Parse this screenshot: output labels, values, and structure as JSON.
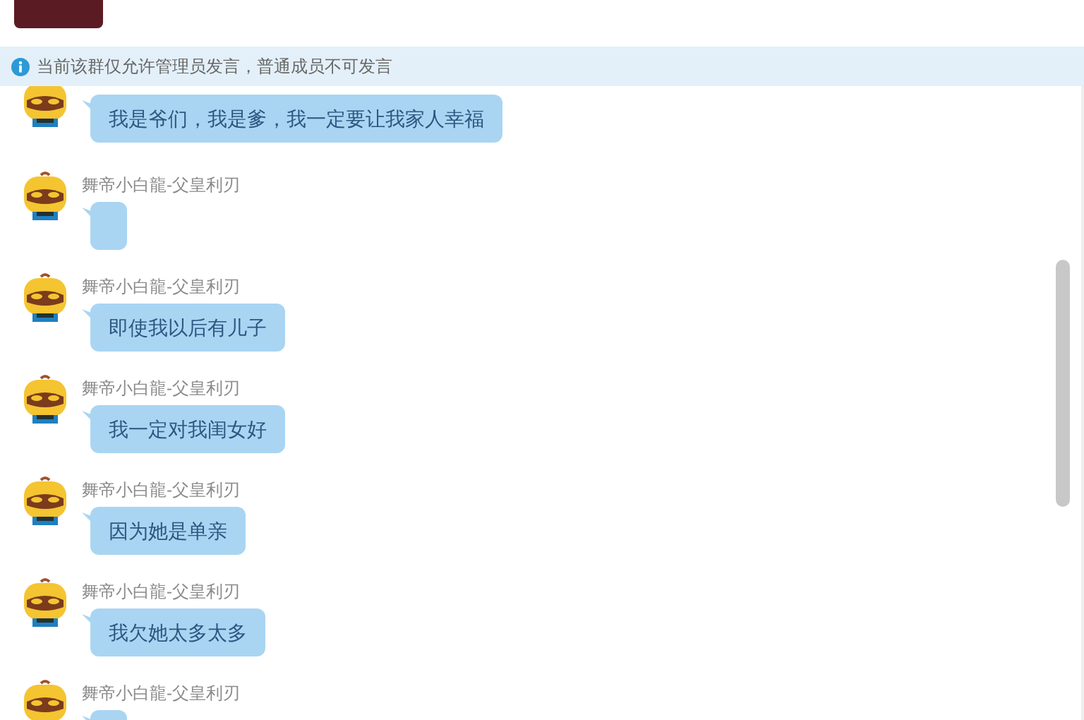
{
  "notice": {
    "text": "当前该群仅允许管理员发言，普通成员不可发言"
  },
  "messages": [
    {
      "text": "我是爷们，我是爹，我一定要让我家人幸福"
    },
    {
      "sender": "舞帝小白龍-父皇利刃"
    },
    {
      "sender": "舞帝小白龍-父皇利刃",
      "text": "即使我以后有儿子"
    },
    {
      "sender": "舞帝小白龍-父皇利刃",
      "text": "我一定对我闺女好"
    },
    {
      "sender": "舞帝小白龍-父皇利刃",
      "text": "因为她是单亲"
    },
    {
      "sender": "舞帝小白龍-父皇利刃",
      "text": "我欠她太多太多"
    },
    {
      "sender": "舞帝小白龍-父皇利刃"
    }
  ]
}
